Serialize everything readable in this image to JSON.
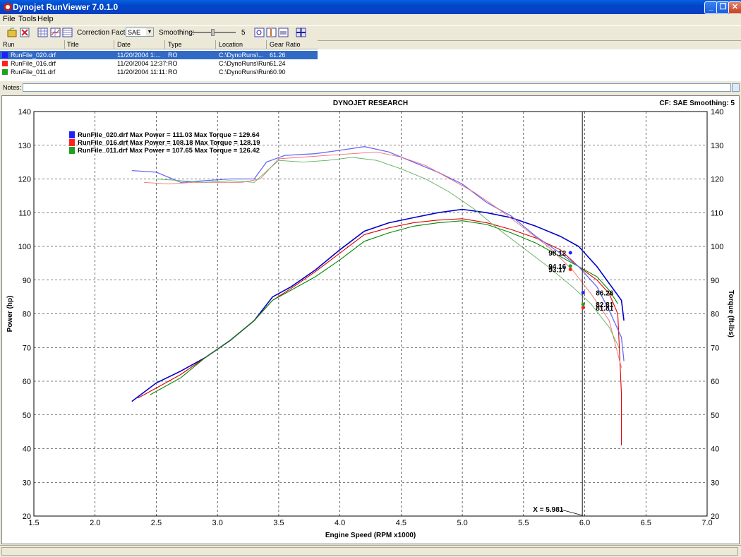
{
  "window": {
    "title": "Dynojet RunViewer 7.0.1.0"
  },
  "menu": [
    "File",
    "Tools",
    "Help"
  ],
  "toolbar": {
    "correction_label": "Correction Factor:",
    "correction_value": "SAE",
    "smoothing_label": "Smoothing:",
    "smoothing_value": "5"
  },
  "columns": [
    "Run",
    "Title",
    "Date",
    "Type",
    "Location",
    "Gear Ratio"
  ],
  "runs": [
    {
      "run": "RunFile_020.drf",
      "title": "",
      "date": "11/20/2004 1:...",
      "type": "RO",
      "location": "C:\\DynoRuns\\...",
      "gear_ratio": "61.26",
      "color": "#2020ff",
      "selected": true
    },
    {
      "run": "RunFile_016.drf",
      "title": "",
      "date": "11/20/2004 12:37:",
      "type": "RO",
      "location": "C:\\DynoRuns\\Run",
      "gear_ratio": "61.24",
      "color": "#ff2020",
      "selected": false
    },
    {
      "run": "RunFile_011.drf",
      "title": "",
      "date": "11/20/2004 11:11:",
      "type": "RO",
      "location": "C:\\DynoRuns\\Run",
      "gear_ratio": "60.90",
      "color": "#20a020",
      "selected": false
    }
  ],
  "notes_label": "Notes:",
  "chart_data": {
    "type": "line",
    "title": "DYNOJET RESEARCH",
    "info": "CF: SAE  Smoothing: 5",
    "xlabel": "Engine Speed (RPM x1000)",
    "ylabel": "Power (hp)",
    "y2label": "Torque (ft-lbs)",
    "xlim": [
      1.5,
      7.0
    ],
    "ylim": [
      20,
      140
    ],
    "xticks": [
      "1.5",
      "2.0",
      "2.5",
      "3.0",
      "3.5",
      "4.0",
      "4.5",
      "5.0",
      "5.5",
      "6.0",
      "6.5",
      "7.0"
    ],
    "yticks": [
      "140",
      "130",
      "120",
      "110",
      "100",
      "90",
      "80",
      "70",
      "60",
      "50",
      "40",
      "30",
      "20"
    ],
    "grid": true,
    "legend_position": "top-left",
    "legend": [
      {
        "text": "RunFile_020.drf Max Power = 111.03 Max Torque = 129.64",
        "color": "#2020ff"
      },
      {
        "text": "RunFile_016.drf Max Power = 108.18 Max Torque = 128.19",
        "color": "#ff2020"
      },
      {
        "text": "RunFile_011.drf Max Power = 107.65 Max Torque = 126.42",
        "color": "#20a020"
      }
    ],
    "cursor": {
      "x": 5.981,
      "label": "X = 5.981"
    },
    "cursor_values": [
      {
        "value": "98.12",
        "y": 98.12,
        "color": "#2020ff",
        "side": "left"
      },
      {
        "value": "94.16",
        "y": 94.16,
        "color": "#20a020",
        "side": "left"
      },
      {
        "value": "93.17",
        "y": 93.17,
        "color": "#ff2020",
        "side": "left"
      },
      {
        "value": "86.26",
        "y": 86.26,
        "color": "#2020ff",
        "side": "right"
      },
      {
        "value": "82.81",
        "y": 82.81,
        "color": "#20a020",
        "side": "right"
      },
      {
        "value": "81.81",
        "y": 81.81,
        "color": "#ff2020",
        "side": "right"
      }
    ],
    "series": [
      {
        "name": "RunFile_020.drf Power",
        "color": "#0000cc",
        "width": 1.6,
        "x": [
          2.3,
          2.5,
          2.7,
          2.9,
          3.1,
          3.3,
          3.45,
          3.6,
          3.8,
          4.0,
          4.2,
          4.4,
          4.6,
          4.8,
          5.0,
          5.2,
          5.4,
          5.6,
          5.8,
          5.95,
          6.1,
          6.2,
          6.3,
          6.32
        ],
        "y": [
          54,
          59.5,
          63,
          67,
          72,
          78,
          85,
          88,
          93,
          99,
          104.5,
          107,
          108.5,
          110,
          111,
          110,
          108.5,
          106,
          103,
          100,
          94,
          89,
          84,
          78
        ]
      },
      {
        "name": "RunFile_016.drf Power",
        "color": "#dd0000",
        "width": 1.1,
        "x": [
          2.35,
          2.5,
          2.7,
          2.9,
          3.1,
          3.3,
          3.45,
          3.6,
          3.8,
          4.0,
          4.2,
          4.4,
          4.6,
          4.8,
          5.0,
          5.2,
          5.4,
          5.6,
          5.8,
          5.95,
          6.1,
          6.2,
          6.27,
          6.3,
          6.3
        ],
        "y": [
          55,
          58,
          62,
          67,
          72,
          78,
          84,
          87.5,
          92.5,
          98,
          103.5,
          105.5,
          107,
          107.8,
          108.2,
          107,
          105,
          102.5,
          99,
          94,
          90,
          86,
          80,
          56,
          41
        ]
      },
      {
        "name": "RunFile_011.drf Power",
        "color": "#008800",
        "width": 1.1,
        "x": [
          2.45,
          2.7,
          2.9,
          3.1,
          3.3,
          3.45,
          3.6,
          3.8,
          4.0,
          4.2,
          4.4,
          4.6,
          4.8,
          5.0,
          5.2,
          5.4,
          5.6,
          5.8,
          5.95,
          6.1,
          6.2,
          6.27
        ],
        "y": [
          56,
          61,
          67,
          72,
          78,
          84,
          87,
          91,
          96,
          101.5,
          104,
          106,
          107,
          107.6,
          106.5,
          104,
          101,
          97,
          94,
          91,
          87,
          83
        ]
      },
      {
        "name": "RunFile_020.drf Torque",
        "color": "#6a6af5",
        "width": 1.3,
        "x": [
          2.3,
          2.5,
          2.7,
          2.9,
          3.1,
          3.3,
          3.4,
          3.55,
          3.8,
          4.0,
          4.2,
          4.4,
          4.6,
          4.8,
          5.0,
          5.2,
          5.4,
          5.6,
          5.8,
          5.95,
          6.1,
          6.2,
          6.3,
          6.32
        ],
        "y": [
          122.5,
          122,
          119,
          119.5,
          120,
          120,
          125,
          127,
          127.5,
          128.5,
          129.6,
          128,
          125,
          122,
          118.5,
          113,
          109,
          103,
          98,
          94,
          88,
          81,
          73,
          66
        ]
      },
      {
        "name": "RunFile_016.drf Torque",
        "color": "#f07070",
        "width": 0.9,
        "x": [
          2.4,
          2.6,
          2.8,
          3.0,
          3.2,
          3.35,
          3.5,
          3.7,
          3.9,
          4.1,
          4.3,
          4.5,
          4.7,
          4.9,
          5.1,
          5.3,
          5.5,
          5.7,
          5.9,
          6.05,
          6.2,
          6.3
        ],
        "y": [
          119,
          118.5,
          119,
          119,
          119,
          120,
          126,
          126.5,
          127,
          127.5,
          128,
          126.5,
          124,
          120,
          116,
          111,
          105.5,
          100,
          93,
          86,
          78,
          64
        ]
      },
      {
        "name": "RunFile_011.drf Torque",
        "color": "#60b060",
        "width": 0.9,
        "x": [
          2.5,
          2.7,
          2.9,
          3.1,
          3.3,
          3.5,
          3.7,
          3.9,
          4.1,
          4.3,
          4.5,
          4.7,
          4.9,
          5.1,
          5.3,
          5.5,
          5.7,
          5.9,
          6.05,
          6.2,
          6.28
        ],
        "y": [
          120,
          119.5,
          119,
          119.5,
          119,
          125.5,
          125,
          125.5,
          126.4,
          125.5,
          123,
          120,
          116,
          111,
          105,
          99.5,
          94,
          88,
          83,
          76,
          70
        ]
      }
    ]
  }
}
